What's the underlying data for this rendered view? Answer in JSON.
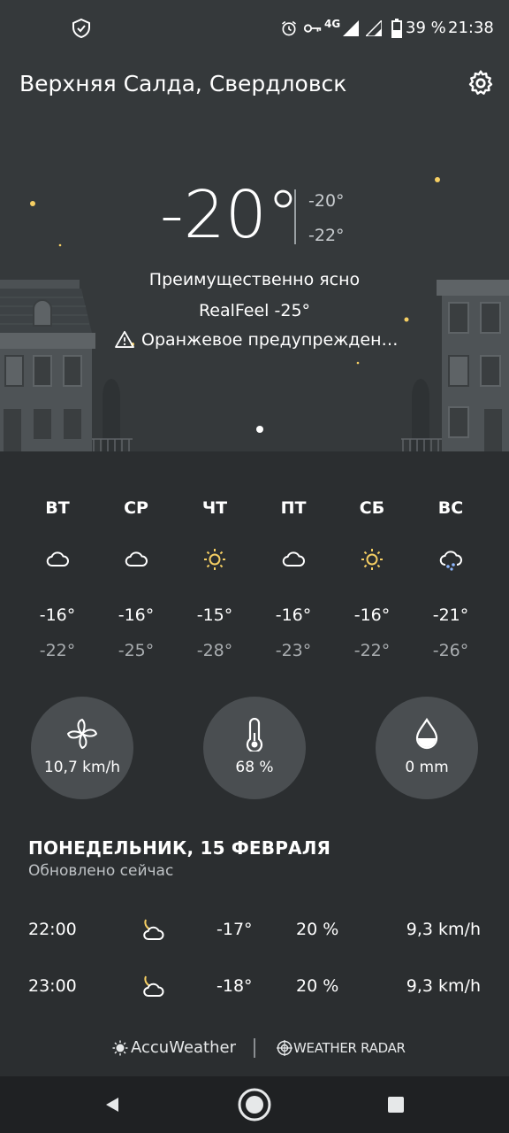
{
  "status_bar": {
    "network": "4G",
    "battery": "39 %",
    "time": "21:38"
  },
  "header": {
    "city": "Верхняя Салда, Свердловск"
  },
  "current": {
    "temperature": "-20°",
    "high": "-20°",
    "low": "-22°",
    "condition": "Преимущественно ясно",
    "realfeel": "RealFeel -25°",
    "alert": "Оранжевое предупрежден…"
  },
  "daily": [
    {
      "day": "ВТ",
      "icon": "cloud-icon",
      "high": "-16°",
      "low": "-22°"
    },
    {
      "day": "СР",
      "icon": "cloud-icon",
      "high": "-16°",
      "low": "-25°"
    },
    {
      "day": "ЧТ",
      "icon": "sun-icon",
      "high": "-15°",
      "low": "-28°"
    },
    {
      "day": "ПТ",
      "icon": "cloud-icon",
      "high": "-16°",
      "low": "-23°"
    },
    {
      "day": "СБ",
      "icon": "sun-icon",
      "high": "-16°",
      "low": "-22°"
    },
    {
      "day": "ВС",
      "icon": "snow-cloud-icon",
      "high": "-21°",
      "low": "-26°"
    }
  ],
  "metrics": {
    "wind": "10,7 km/h",
    "humidity": "68 %",
    "precipitation": "0 mm"
  },
  "today": {
    "title": "ПОНЕДЕЛЬНИК, 15 ФЕВРАЛЯ",
    "updated": "Обновлено сейчас"
  },
  "hourly": [
    {
      "time": "22:00",
      "icon": "moon-cloud-icon",
      "temp": "-17°",
      "precip": "20 %",
      "wind": "9,3 km/h"
    },
    {
      "time": "23:00",
      "icon": "moon-cloud-icon",
      "temp": "-18°",
      "precip": "20 %",
      "wind": "9,3 km/h"
    }
  ],
  "footer": {
    "brand1": "AccuWeather",
    "brand2": "WEATHER RADAR"
  },
  "colors": {
    "background": "#2b2e30",
    "hero": "#35393b",
    "accent_yellow": "#f6cf63",
    "circle": "#4a4e51"
  }
}
